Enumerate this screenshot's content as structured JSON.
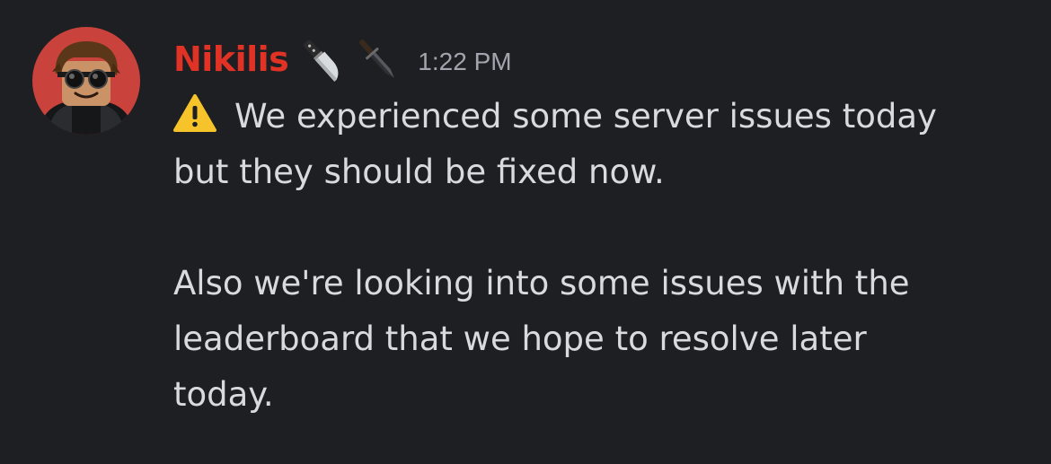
{
  "message": {
    "author": {
      "name": "Nikilis",
      "name_color": "#e03326",
      "avatar": "roblox-avatar-with-sunglasses",
      "tag_icons": [
        "kitchen-knife-icon",
        "dagger-icon"
      ]
    },
    "timestamp": "1:22 PM",
    "leading_icon": "warning-icon",
    "paragraphs": [
      "We experienced some server issues today\nbut they should be fixed now.",
      "Also we're looking into some issues with the\nleaderboard that we hope to resolve later\ntoday."
    ]
  },
  "colors": {
    "background": "#1e1f22",
    "text": "#d9dadd",
    "timestamp": "#a2a5ad"
  }
}
